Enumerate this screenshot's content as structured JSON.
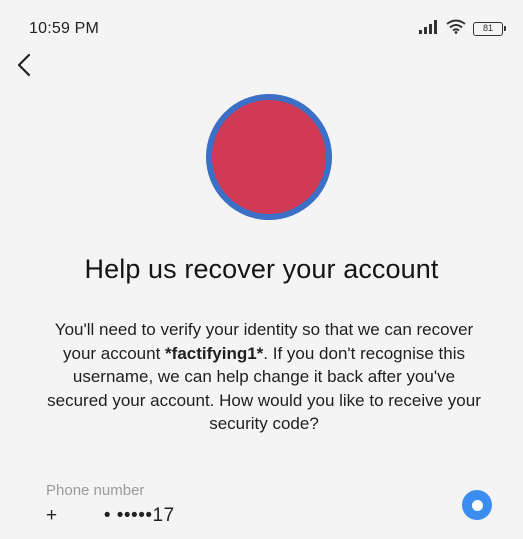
{
  "status_bar": {
    "time": "10:59 PM",
    "battery": "81",
    "icons": [
      "signal-icon",
      "wifi-icon",
      "battery-icon"
    ]
  },
  "header": {
    "back_icon": "chevron-left-icon"
  },
  "avatar": {
    "fill_color": "#d03a54",
    "ring_color": "#3b70c6"
  },
  "main": {
    "title": "Help us recover your account",
    "description_pre": "You'll need to verify your identity so that we can recover your account ",
    "username": "*factifying1*",
    "description_post": ". If you don't recognise this username, we can help change it back after you've secured your account. How would you like to receive your security code?"
  },
  "option": {
    "label": "Phone number",
    "value": "+        • •••••17",
    "selected": true,
    "accent_color": "#3b8ef0"
  }
}
